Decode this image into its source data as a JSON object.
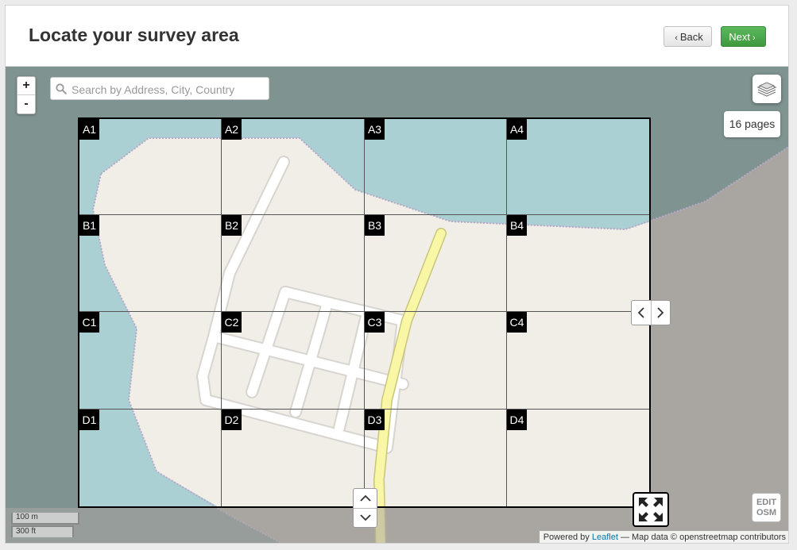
{
  "header": {
    "title": "Locate your survey area",
    "back_label": "Back",
    "next_label": "Next"
  },
  "map": {
    "zoom_in": "+",
    "zoom_out": "-",
    "search_placeholder": "Search by Address, City, Country",
    "pages_label": "16 pages",
    "edit_osm_line1": "EDIT",
    "edit_osm_line2": "OSM",
    "scale_metric": "100 m",
    "scale_imperial": "300 ft",
    "attribution": {
      "prefix": "Powered by",
      "leaflet": "Leaflet",
      "rest": "— Map data © openstreetmap contributors"
    }
  },
  "grid": {
    "rows": [
      "A",
      "B",
      "C",
      "D"
    ],
    "cols": [
      "1",
      "2",
      "3",
      "4"
    ],
    "labels": [
      [
        "A1",
        "A2",
        "A3",
        "A4"
      ],
      [
        "B1",
        "B2",
        "B3",
        "B4"
      ],
      [
        "C1",
        "C2",
        "C3",
        "C4"
      ],
      [
        "D1",
        "D2",
        "D3",
        "D4"
      ]
    ]
  },
  "icons": {
    "search": "search-icon",
    "layers": "layers-icon",
    "expand": "expand-icon"
  },
  "colors": {
    "next_button": "#4cae4c",
    "water": "#a9d0d4",
    "land": "#f1eee8",
    "road_major": "#f9f7a6"
  }
}
